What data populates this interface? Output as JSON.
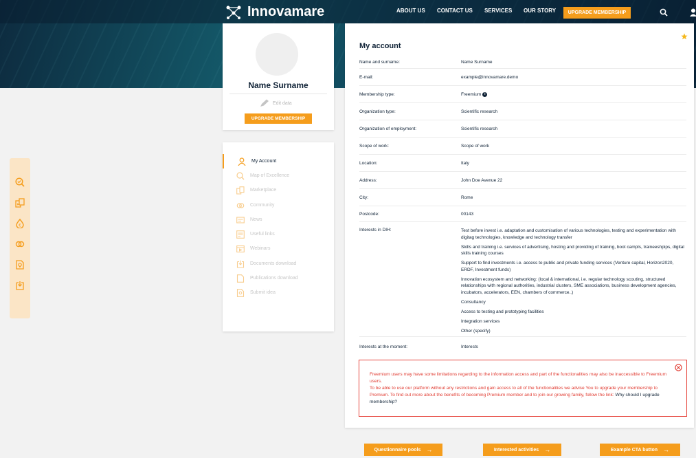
{
  "brand": {
    "name": "Innovamare"
  },
  "nav": {
    "items": [
      "ABOUT US",
      "CONTACT US",
      "SERVICES",
      "OUR STORY"
    ],
    "upgrade_label": "UPGRADE MEMBERSHIP",
    "icons": [
      "search-icon",
      "user-icon"
    ]
  },
  "profile": {
    "name": "Name Surname",
    "edit_label": "Edit data",
    "upgrade_label": "UPGRADE MEMBERSHIP"
  },
  "sidebar": {
    "items": [
      {
        "label": "My Account",
        "icon": "user-icon",
        "active": true
      },
      {
        "label": "Map of Excellence",
        "icon": "map-search-icon"
      },
      {
        "label": "Marketplace",
        "icon": "marketplace-icon"
      },
      {
        "label": "Community",
        "icon": "community-icon"
      },
      {
        "label": "News",
        "icon": "news-icon"
      },
      {
        "label": "Useful links",
        "icon": "links-icon"
      },
      {
        "label": "Webinars",
        "icon": "webinar-icon"
      },
      {
        "label": "Documents download",
        "icon": "document-download-icon"
      },
      {
        "label": "Publications download",
        "icon": "publication-icon"
      },
      {
        "label": "Submit idea",
        "icon": "idea-icon"
      }
    ]
  },
  "account": {
    "title": "My account",
    "rows": [
      {
        "key": "Name and surname:",
        "value": "Name Surname"
      },
      {
        "key": "E-mail:",
        "value": "example@innovamare.demo"
      },
      {
        "key": "Membership type:",
        "value": "Freemium"
      },
      {
        "key": "Organization type:",
        "value": "Scientific research"
      },
      {
        "key": "Organization of employment:",
        "value": "Scientific research"
      },
      {
        "key": "Scope of work:",
        "value": "Scope of work"
      },
      {
        "key": "Location:",
        "value": "Italy"
      },
      {
        "key": "Address:",
        "value": "John Doe Avenue 22"
      },
      {
        "key": "City:",
        "value": "Rome"
      },
      {
        "key": "Postcode:",
        "value": "00143"
      }
    ],
    "interests_key": "Interests in DIH:",
    "interests": [
      "Test before invest i.e. adaptation and customisation of various technologies, testing and experimentation with digitag technologies, knowledge and technology transfer",
      "Skills and training i.e. services of advertising, hosting and providing of training, boot campls, traineeshpips, digital skills training courses",
      "Support to find investments i.e. access to public and private funding services (Venture capital, Horizon2020, ERDF, Investment funds)",
      "Innovation ecosystem and networking: (local & international, i.e. regular technology scouting, structured relationships with regional authorities, industrial clusters, SME associations, business development agencies, incubators, accelerators, EEN, chambers of commerce..)",
      "Consultancy",
      "Access to testing and prototyping facilities",
      "Integration services",
      "Other (specify)"
    ],
    "moment_key": "Interests at the moment:",
    "moment_value": "Interests"
  },
  "alert": {
    "line1": "Freemium users may have some limitations regarding to the information access and part of the functionalities may also be inaccessible to Freemium users.",
    "line2": "To be able to use our platform without any restrictions and gain access to all of the functionalities we advise You to upgrade your membership to Premium. To find out more about the benefits of becoming Premium member and to join our growing family, follow the link:",
    "link": "Why should I upgrade membership?"
  },
  "cta": {
    "questionnaire": "Questionnaire pools",
    "interested": "Interested activities",
    "example": "Example CTA button",
    "arrow": "→"
  },
  "colors": {
    "accent": "#f59d1c",
    "navy": "#0f2236",
    "alert": "#e03a30"
  }
}
